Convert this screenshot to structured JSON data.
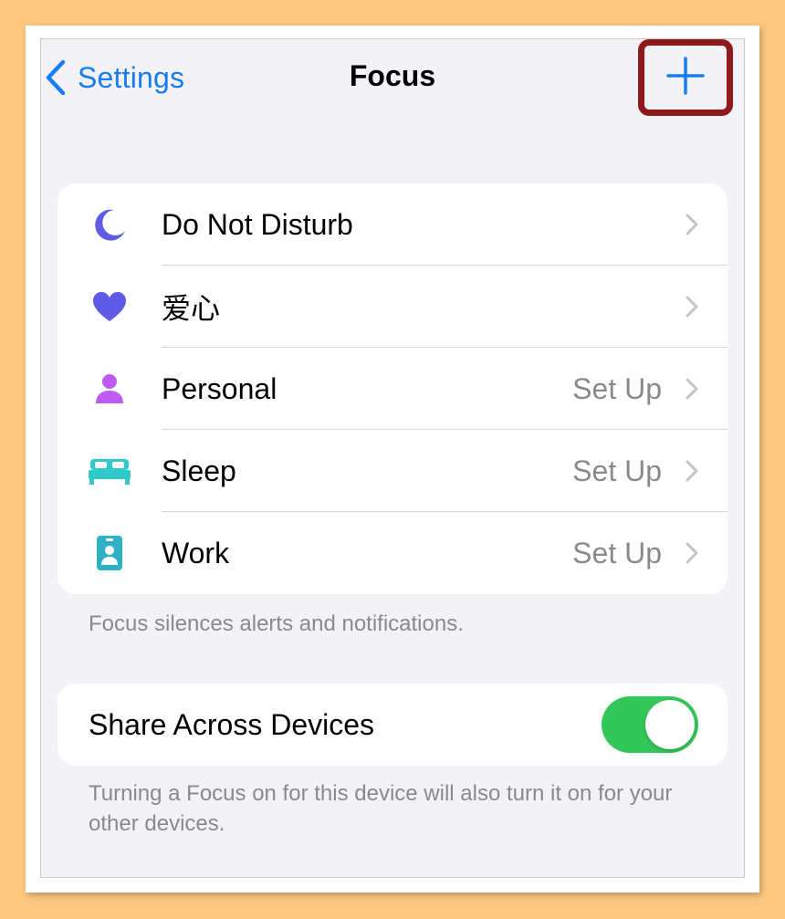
{
  "nav": {
    "back_label": "Settings",
    "title": "Focus",
    "add_icon": "plus-icon"
  },
  "focus_modes": [
    {
      "label": "Do Not Disturb",
      "value": "",
      "icon": "moon-icon",
      "icon_color": "#5e5ce6"
    },
    {
      "label": "爱心",
      "value": "",
      "icon": "heart-icon",
      "icon_color": "#5e5ce6"
    },
    {
      "label": "Personal",
      "value": "Set Up",
      "icon": "person-icon",
      "icon_color": "#bf5af2"
    },
    {
      "label": "Sleep",
      "value": "Set Up",
      "icon": "bed-icon",
      "icon_color": "#30c8c8"
    },
    {
      "label": "Work",
      "value": "Set Up",
      "icon": "id-badge-icon",
      "icon_color": "#30b0c7"
    }
  ],
  "focus_footnote": "Focus silences alerts and notifications.",
  "share": {
    "label": "Share Across Devices",
    "enabled": true,
    "footnote": "Turning a Focus on for this device will also turn it on for your other devices."
  },
  "colors": {
    "accent": "#1a7cf5",
    "toggle_on": "#33c759",
    "highlight_box": "#8f1a1e",
    "background": "#f2f2f7"
  }
}
